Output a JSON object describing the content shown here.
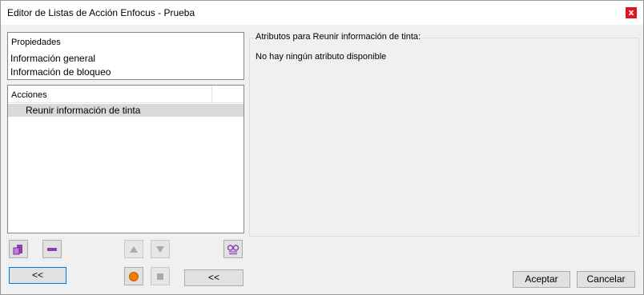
{
  "window": {
    "title": "Editor de Listas de Acción Enfocus - Prueba",
    "close_glyph": "x"
  },
  "properties": {
    "header": "Propiedades",
    "items": [
      "Información general",
      "Información de bloqueo"
    ]
  },
  "actions": {
    "header": "Acciones",
    "items": [
      "Reunir información de tinta"
    ]
  },
  "attributes": {
    "legend": "Atributos para Reunir información de tinta:",
    "empty_message": "No hay ningún atributo disponible"
  },
  "toolbar": {
    "icons": [
      "add-action-icon",
      "remove-action-icon",
      "move-up-icon",
      "move-down-icon",
      "inspect-glasses-icon",
      "record-icon",
      "stop-icon"
    ],
    "collapse_left_label": "<<",
    "collapse_middle_label": "<<"
  },
  "footer": {
    "accept_label": "Aceptar",
    "cancel_label": "Cancelar"
  },
  "colors": {
    "close_button": "#e81123",
    "accent_purple": "#8a3fb0",
    "record_orange": "#f07d00",
    "focus_border": "#0078d7"
  }
}
